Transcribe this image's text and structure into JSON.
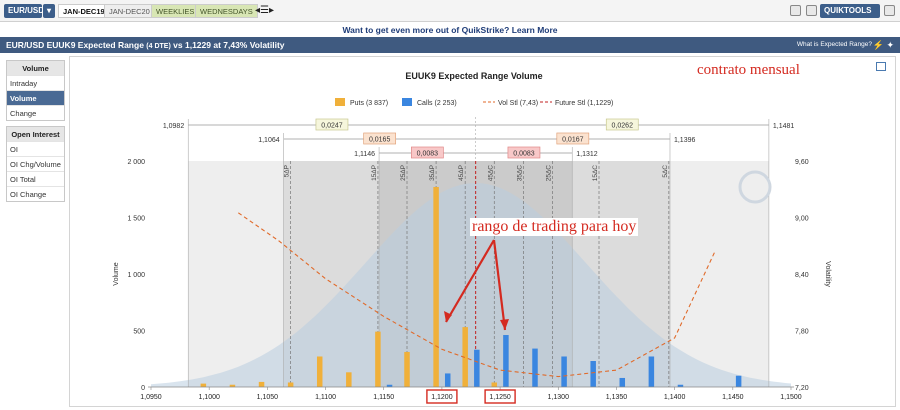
{
  "topbar": {
    "symbol": "EUR/USD",
    "tabs": [
      "JAN-DEC19",
      "JAN-DEC20",
      "WEEKLIES",
      "WEDNESDAYS"
    ],
    "tools": "QUIKTOOLS"
  },
  "promo": "Want to get even more out of QuikStrike? Learn More",
  "title": {
    "main": "EUR/USD EUUK9 Expected Range",
    "dte": "(4 DTE)",
    "rest": "vs 1,1229 at 7,43% Volatility",
    "help": "What is Expected Range?"
  },
  "sidebar": {
    "volume": {
      "header": "Volume",
      "items": [
        "Intraday",
        "Volume",
        "Change"
      ],
      "active": "Volume"
    },
    "oi": {
      "header": "Open Interest",
      "items": [
        "OI",
        "OI Chg/Volume",
        "OI Total",
        "OI Change"
      ]
    }
  },
  "annotations": {
    "note": "contrato mensual",
    "range": "rango de trading para hoy"
  },
  "chart_data": {
    "type": "bar",
    "title": "EUUK9 Expected Range Volume",
    "legend": [
      {
        "name": "Puts (3 837)",
        "color": "#f0b03a"
      },
      {
        "name": "Calls (2 253)",
        "color": "#3a86e0"
      },
      {
        "name": "Vol Stl (7,43)",
        "color": "#e06a2a",
        "style": "dashed"
      },
      {
        "name": "Future Stl (1,1229)",
        "color": "#c02020",
        "style": "dashed"
      }
    ],
    "xlabel": "",
    "ylabel": "Volume",
    "y2label": "Volatility",
    "xlim": [
      1.095,
      1.15
    ],
    "ylim": [
      0,
      2000
    ],
    "y2lim": [
      7.2,
      9.6
    ],
    "xticks": [
      "1,0950",
      "1,1000",
      "1,1050",
      "1,1100",
      "1,1150",
      "1,1200",
      "1,1250",
      "1,1300",
      "1,1350",
      "1,1400",
      "1,1450",
      "1,1500"
    ],
    "xtick_values": [
      1.095,
      1.1,
      1.105,
      1.11,
      1.115,
      1.12,
      1.125,
      1.13,
      1.135,
      1.14,
      1.145,
      1.15
    ],
    "highlighted_xticks": [
      "1,1200",
      "1,1250"
    ],
    "yticks": [
      "0",
      "500",
      "1 000",
      "1 500",
      "2 000"
    ],
    "ytick_values": [
      0,
      500,
      1000,
      1500,
      2000
    ],
    "y2ticks": [
      "7,20",
      "7,80",
      "8,40",
      "9,00",
      "9,60"
    ],
    "y2tick_values": [
      7.2,
      7.8,
      8.4,
      9.0,
      9.6
    ],
    "puts": [
      {
        "x": 1.0995,
        "v": 30
      },
      {
        "x": 1.102,
        "v": 20
      },
      {
        "x": 1.1045,
        "v": 45
      },
      {
        "x": 1.107,
        "v": 40
      },
      {
        "x": 1.1095,
        "v": 270
      },
      {
        "x": 1.112,
        "v": 130
      },
      {
        "x": 1.1145,
        "v": 490
      },
      {
        "x": 1.117,
        "v": 310
      },
      {
        "x": 1.1195,
        "v": 1770
      },
      {
        "x": 1.122,
        "v": 530
      },
      {
        "x": 1.1245,
        "v": 40
      }
    ],
    "calls": [
      {
        "x": 1.1155,
        "v": 20
      },
      {
        "x": 1.1205,
        "v": 120
      },
      {
        "x": 1.123,
        "v": 330
      },
      {
        "x": 1.1255,
        "v": 460
      },
      {
        "x": 1.128,
        "v": 340
      },
      {
        "x": 1.1305,
        "v": 270
      },
      {
        "x": 1.133,
        "v": 230
      },
      {
        "x": 1.1355,
        "v": 80
      },
      {
        "x": 1.138,
        "v": 270
      },
      {
        "x": 1.1405,
        "v": 20
      },
      {
        "x": 1.1455,
        "v": 100
      }
    ],
    "vol_curve": [
      {
        "x": 1.1025,
        "v": 9.05
      },
      {
        "x": 1.106,
        "v": 8.75
      },
      {
        "x": 1.11,
        "v": 8.35
      },
      {
        "x": 1.115,
        "v": 7.95
      },
      {
        "x": 1.12,
        "v": 7.6
      },
      {
        "x": 1.125,
        "v": 7.38
      },
      {
        "x": 1.13,
        "v": 7.31
      },
      {
        "x": 1.135,
        "v": 7.38
      },
      {
        "x": 1.14,
        "v": 7.72
      },
      {
        "x": 1.1435,
        "v": 8.65
      }
    ],
    "future_settle": 1.1229,
    "strike_lines": [
      {
        "x": 1.107,
        "label": "5ΔP"
      },
      {
        "x": 1.1145,
        "label": "15ΔP"
      },
      {
        "x": 1.117,
        "label": "25ΔP"
      },
      {
        "x": 1.1195,
        "label": "35ΔP"
      },
      {
        "x": 1.122,
        "label": "45ΔP"
      },
      {
        "x": 1.1245,
        "label": "45ΔC"
      },
      {
        "x": 1.127,
        "label": "35ΔC"
      },
      {
        "x": 1.1295,
        "label": "25ΔC"
      },
      {
        "x": 1.1335,
        "label": "15ΔC"
      },
      {
        "x": 1.1395,
        "label": "5ΔC"
      }
    ],
    "ranges": [
      {
        "left": "1,0982",
        "right": "1,1481",
        "width": "0,0247",
        "width_right": "0,0262",
        "lo": 1.0982,
        "hi": 1.1481,
        "color": "#f6f6dc",
        "border": "#c8c890"
      },
      {
        "left": "1,1064",
        "right": "1,1396",
        "width": "0,0165",
        "width_right": "0,0167",
        "lo": 1.1064,
        "hi": 1.1396,
        "color": "#fbe2cf",
        "border": "#e2a47c"
      },
      {
        "left": "1,1146",
        "right": "1,1312",
        "width": "0,0083",
        "width_right": "0,0083",
        "lo": 1.1146,
        "hi": 1.1312,
        "color": "#f8c8c8",
        "border": "#e08888"
      }
    ]
  }
}
